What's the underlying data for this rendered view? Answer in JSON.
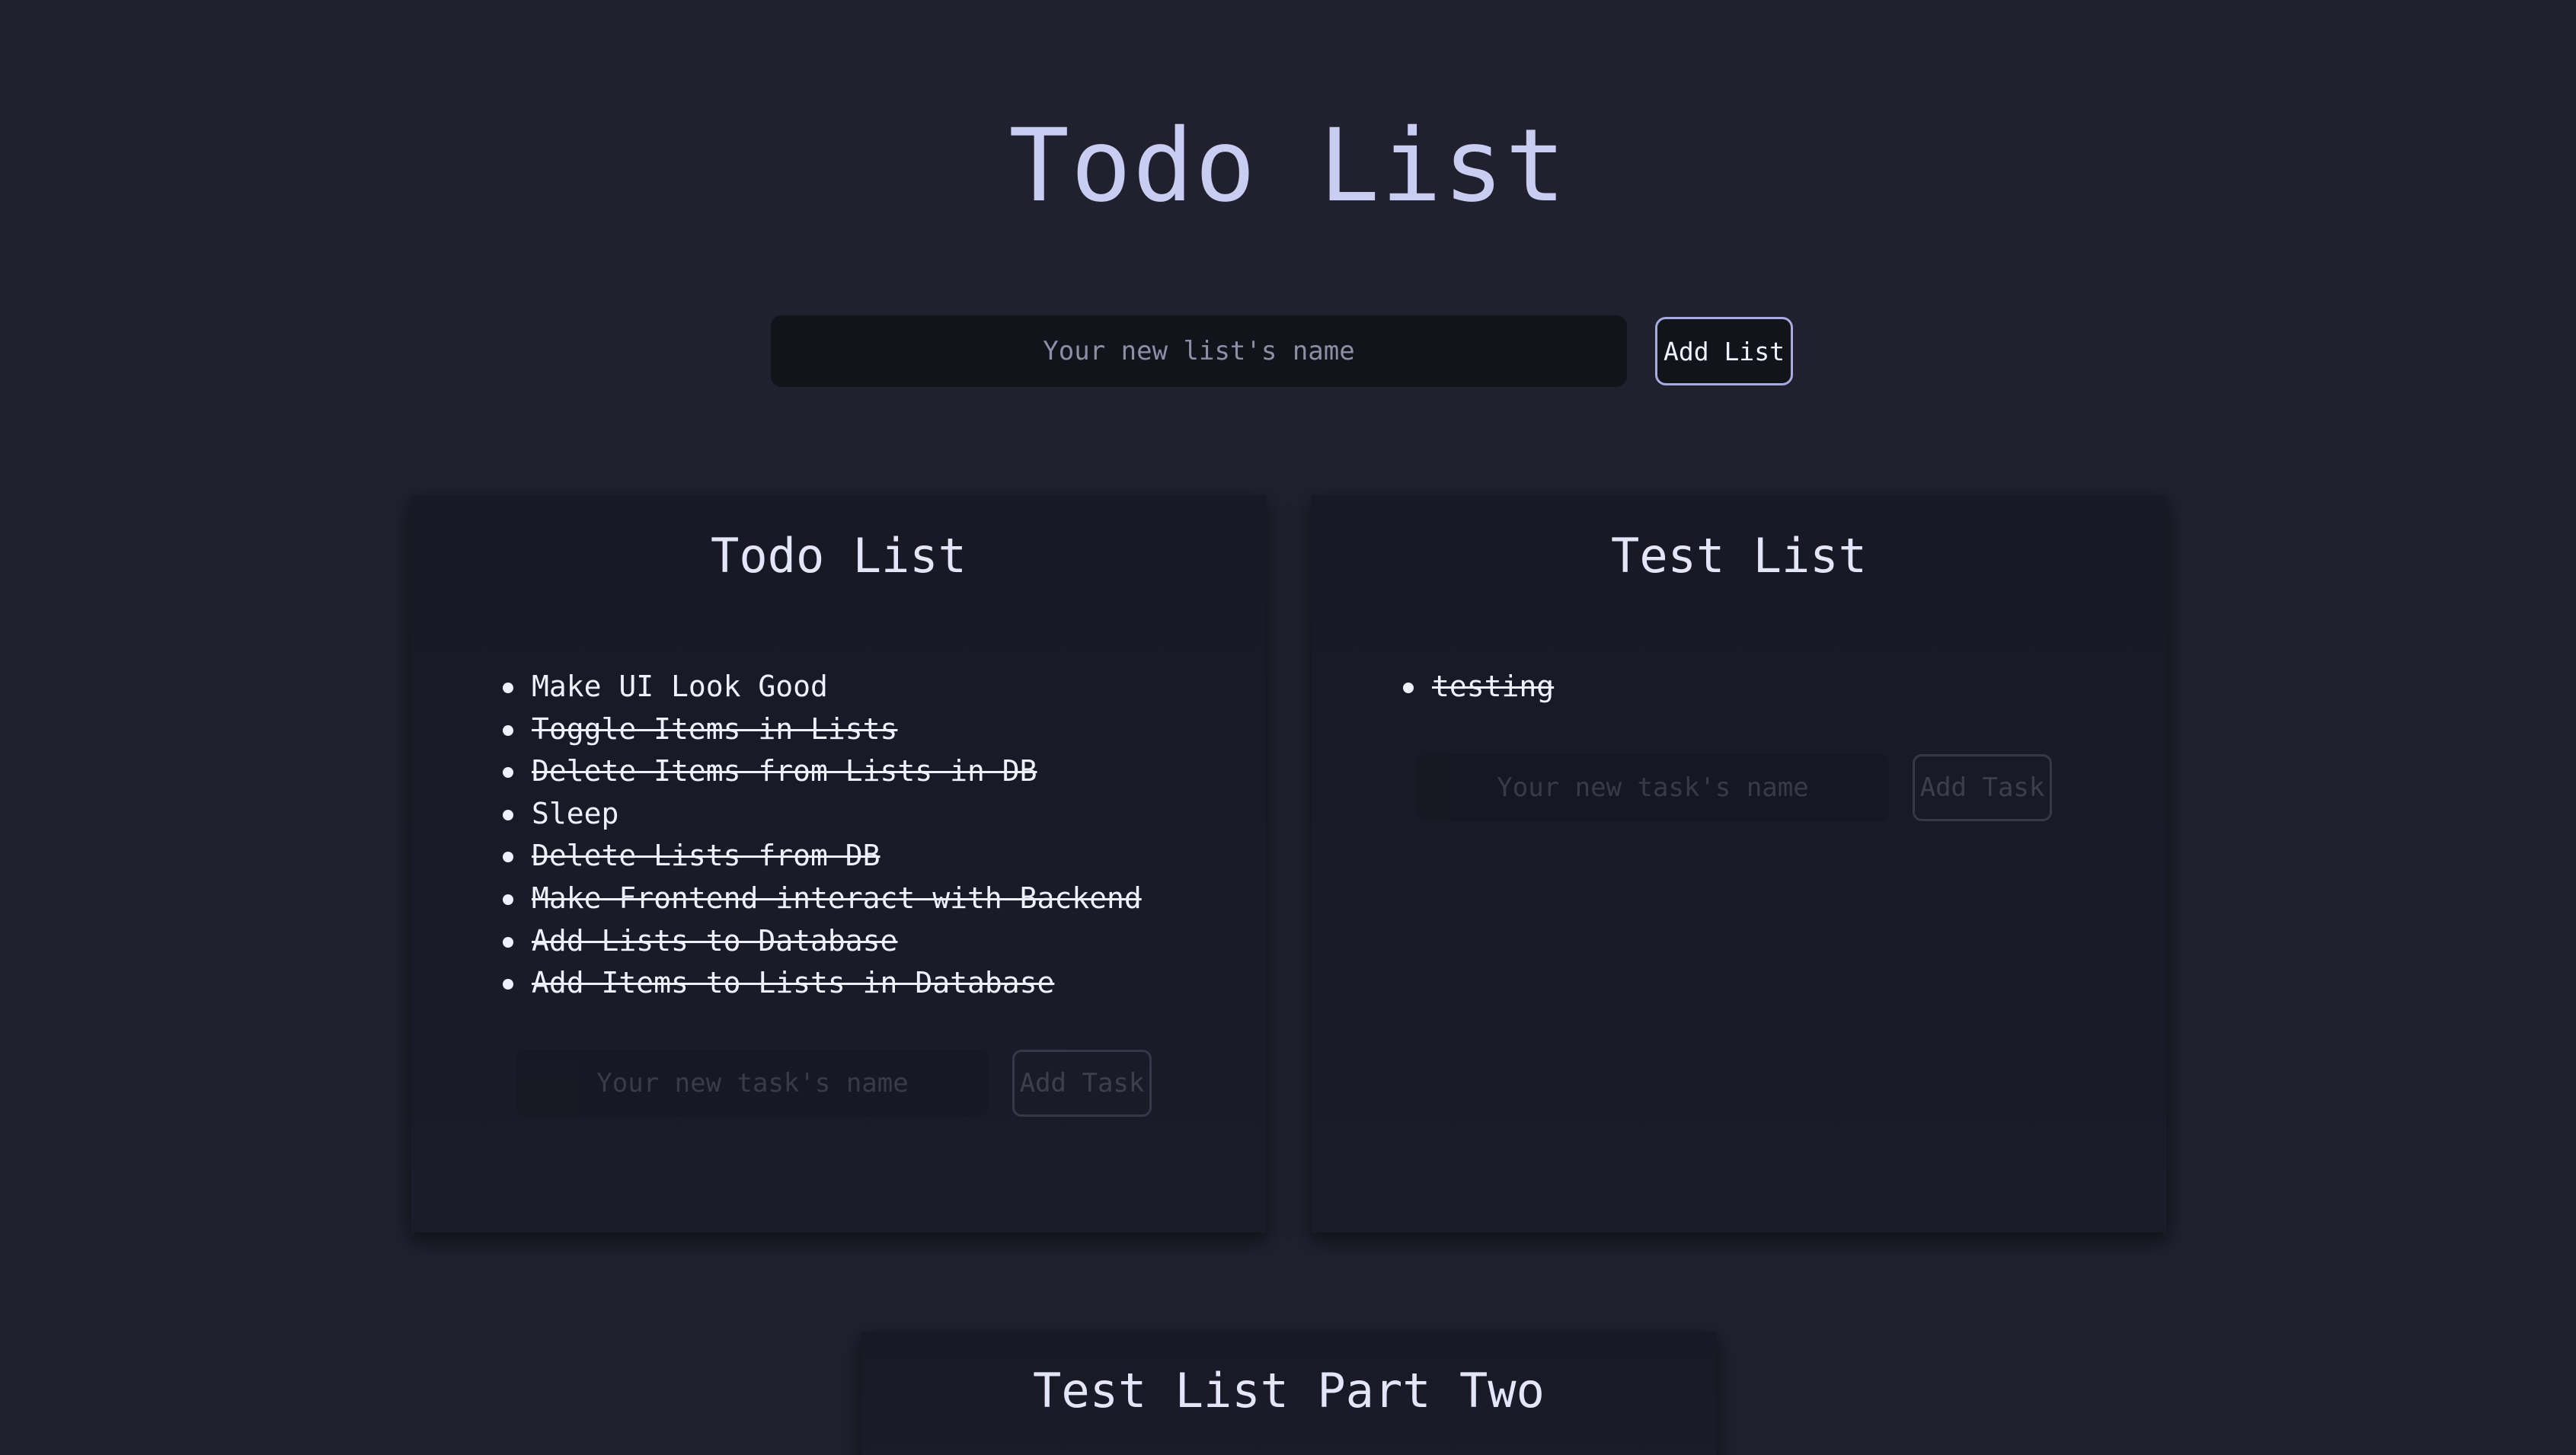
{
  "app": {
    "title": "Todo List"
  },
  "new_list": {
    "placeholder": "Your new list's name",
    "value": "",
    "button_label": "Add List"
  },
  "lists": [
    {
      "title": "Todo List",
      "items": [
        {
          "text": "Make UI Look Good",
          "done": false
        },
        {
          "text": "Toggle Items in Lists",
          "done": true
        },
        {
          "text": "Delete Items from Lists in DB",
          "done": true
        },
        {
          "text": "Sleep",
          "done": false
        },
        {
          "text": "Delete Lists from DB",
          "done": true
        },
        {
          "text": "Make Frontend interact with Backend",
          "done": true
        },
        {
          "text": "Add Lists to Database",
          "done": true
        },
        {
          "text": "Add Items to Lists in Database",
          "done": true
        }
      ],
      "new_task_placeholder": "Your new task's name",
      "add_task_label": "Add Task"
    },
    {
      "title": "Test List",
      "items": [
        {
          "text": "testing",
          "done": true
        }
      ],
      "new_task_placeholder": "Your new task's name",
      "add_task_label": "Add Task"
    },
    {
      "title": "Test List Part Two",
      "items": []
    }
  ],
  "colors": {
    "background": "#20202e",
    "card": "#1a1a27",
    "input": "#13131c",
    "accent": "#a7abe0",
    "title": "#c9cdf2"
  }
}
